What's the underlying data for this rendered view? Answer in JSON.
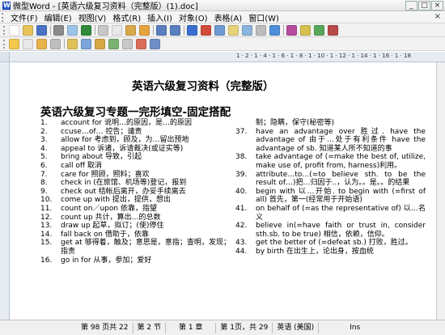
{
  "window": {
    "title": "微型Word - [英语六级复习资料（完整版）(1).doc]"
  },
  "menu": [
    "文件(F)",
    "编辑(E)",
    "视图(V)",
    "格式(R)",
    "插入(I)",
    "对象(O)",
    "表格(A)",
    "窗口(W)"
  ],
  "document": {
    "title": "英语六级复习资料（完整版）",
    "heading": "英语六级复习专题一完形填空-固定搭配",
    "left": [
      [
        "1.",
        "account for 说明…的原因，是…的原因"
      ],
      [
        "2.",
        "ccuse…of… 控告；谴责"
      ],
      [
        "3.",
        "allow for 考虑到，顾及，为…留出预地"
      ],
      [
        "4.",
        "appeal to 诉诸，诉请裁决(或证实等)"
      ],
      [
        "5.",
        "bring about 导致，引起"
      ],
      [
        "6.",
        "call off 取消"
      ],
      [
        "7.",
        "care for 照顾，照料；喜欢"
      ],
      [
        "8.",
        "check in (在旅馆、机场等)登记，报到"
      ],
      [
        "9.",
        "check out 结帐后离开，办妥手续离去"
      ],
      [
        "10.",
        "come up with 提出，提供，想出"
      ],
      [
        "11.",
        "count on／upon 依靠，指望"
      ],
      [
        "12.",
        "count up 共计，算出…的总数"
      ],
      [
        "13.",
        "draw up 起草，拟订；(使)停住"
      ],
      [
        "14.",
        "fall back on 借助于，依靠"
      ],
      [
        "15.",
        "get at 够得着，触及；意思是，意指；查明，发现；指责"
      ],
      [
        "16.",
        "go in for 从事，参加；爱好"
      ]
    ],
    "right": [
      [
        "",
        "制；隐瞒，保守(秘密等)"
      ],
      [
        "37.",
        "have an advantage over 胜过. have the advantage of 由于…处于有利条件 have the advantage of sb. 知道某人所不知道的事"
      ],
      [
        "38.",
        "take advantage of (=make the best of, utilize, make use of, profit from, harness)利用。"
      ],
      [
        "39.",
        "attribute…to…(=to believe sth. to be the result of…)把…归因于..，认为。。是。。的结果"
      ],
      [
        "40.",
        "begin with 以…开始. to begin with (=first of all) 首先，第一(经常用于开始语)"
      ],
      [
        "41.",
        "on behalf of (=as the representative of) 以…名义"
      ],
      [
        "42.",
        "believe in(=have faith or trust in, consider sth.sb. to be true) 相信，依赖，信仰。"
      ],
      [
        "43.",
        "get the better of (=defeat sb.) 打败，胜过。"
      ],
      [
        "44.",
        "by birth 在出生上，论出身，按血统"
      ]
    ]
  },
  "status": [
    "第 98 页共 22",
    "第 2 节",
    "第 1 章",
    "第 1页，共 29",
    "英语 (美国)",
    "Ins"
  ]
}
